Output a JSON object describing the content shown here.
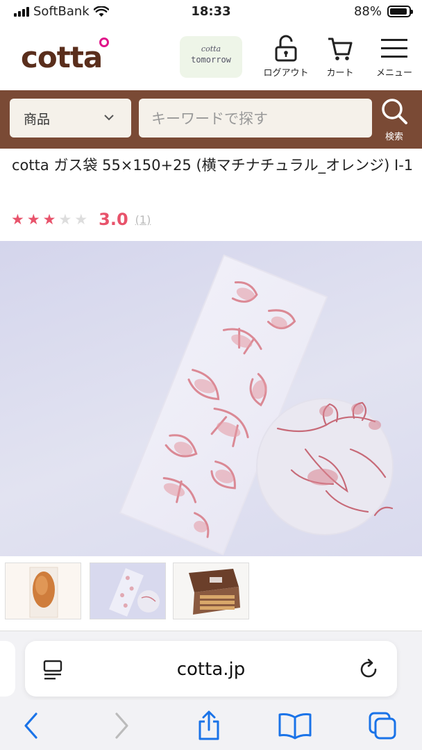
{
  "status_bar": {
    "carrier": "SoftBank",
    "time": "18:33",
    "battery": "88%",
    "battery_level": 0.88
  },
  "header": {
    "logo": "cotta",
    "tomorrow_logo": {
      "line1": "cotta",
      "line2": "tomorrow"
    },
    "logout_label": "ログアウト",
    "cart_label": "カート",
    "menu_label": "メニュー"
  },
  "search": {
    "category": "商品",
    "placeholder": "キーワードで探す",
    "button_label": "検索"
  },
  "product": {
    "title": "cotta ガス袋 55×150+25 (横マチナチュラル_オレンジ) I-1",
    "rating": "3.0",
    "rating_value": 3,
    "rating_max": 5,
    "review_count": "(1)"
  },
  "thumbnails": [
    {
      "name": "thumbnail-cake"
    },
    {
      "name": "thumbnail-bag"
    },
    {
      "name": "thumbnail-box"
    }
  ],
  "browser": {
    "url": "cotta.jp"
  },
  "colors": {
    "brand_brown": "#7a4a35",
    "logo_brown": "#5a2e1c",
    "accent_pink": "#e8536b",
    "ios_blue": "#1a73e8"
  }
}
